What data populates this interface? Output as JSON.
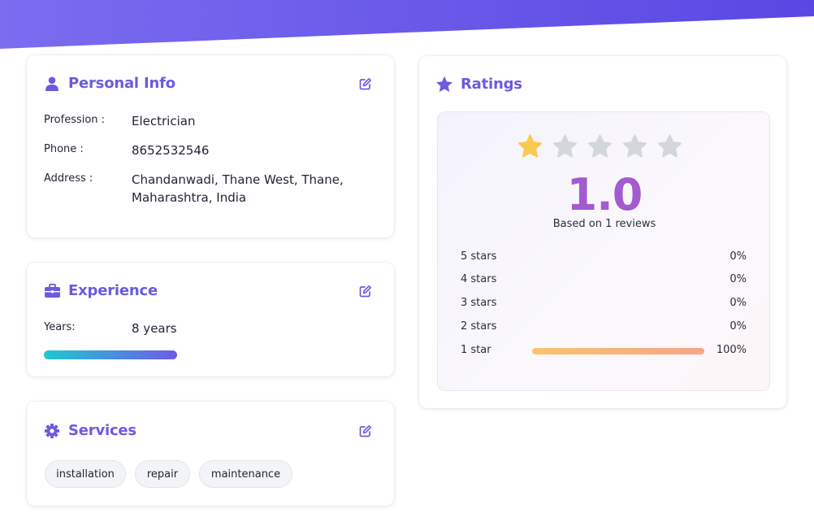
{
  "personal_info": {
    "title": "Personal Info",
    "icon": "user-icon",
    "edit_icon": "edit-icon",
    "fields": [
      {
        "label": "Profession :",
        "value": "Electrician"
      },
      {
        "label": "Phone :",
        "value": "8652532546"
      },
      {
        "label": "Address :",
        "value": "Chandanwadi, Thane West, Thane, Maharashtra, India"
      }
    ]
  },
  "experience": {
    "title": "Experience",
    "icon": "briefcase-icon",
    "edit_icon": "edit-icon",
    "years_label": "Years:",
    "years_value": "8 years",
    "bar_colors": [
      "#1fc8cf",
      "#6c5ce7"
    ]
  },
  "services": {
    "title": "Services",
    "icon": "gear-icon",
    "edit_icon": "edit-icon",
    "tags": [
      "installation",
      "repair",
      "maintenance"
    ]
  },
  "ratings": {
    "title": "Ratings",
    "icon": "star-icon",
    "score": "1.0",
    "filled_stars": 1,
    "total_stars": 5,
    "based_on": "Based on 1 reviews",
    "distribution": [
      {
        "label": "5 stars",
        "percent": "0%",
        "fraction": 0
      },
      {
        "label": "4 stars",
        "percent": "0%",
        "fraction": 0
      },
      {
        "label": "3 stars",
        "percent": "0%",
        "fraction": 0
      },
      {
        "label": "2 stars",
        "percent": "0%",
        "fraction": 0
      },
      {
        "label": "1 star",
        "percent": "100%",
        "fraction": 1
      }
    ]
  },
  "colors": {
    "accent": "#6a5be0",
    "banner_start": "#7b6cf0",
    "banner_end": "#5a47e3",
    "star_filled": "#fbc94f",
    "star_empty": "#d4d6dd",
    "score": "#a35bd0"
  }
}
